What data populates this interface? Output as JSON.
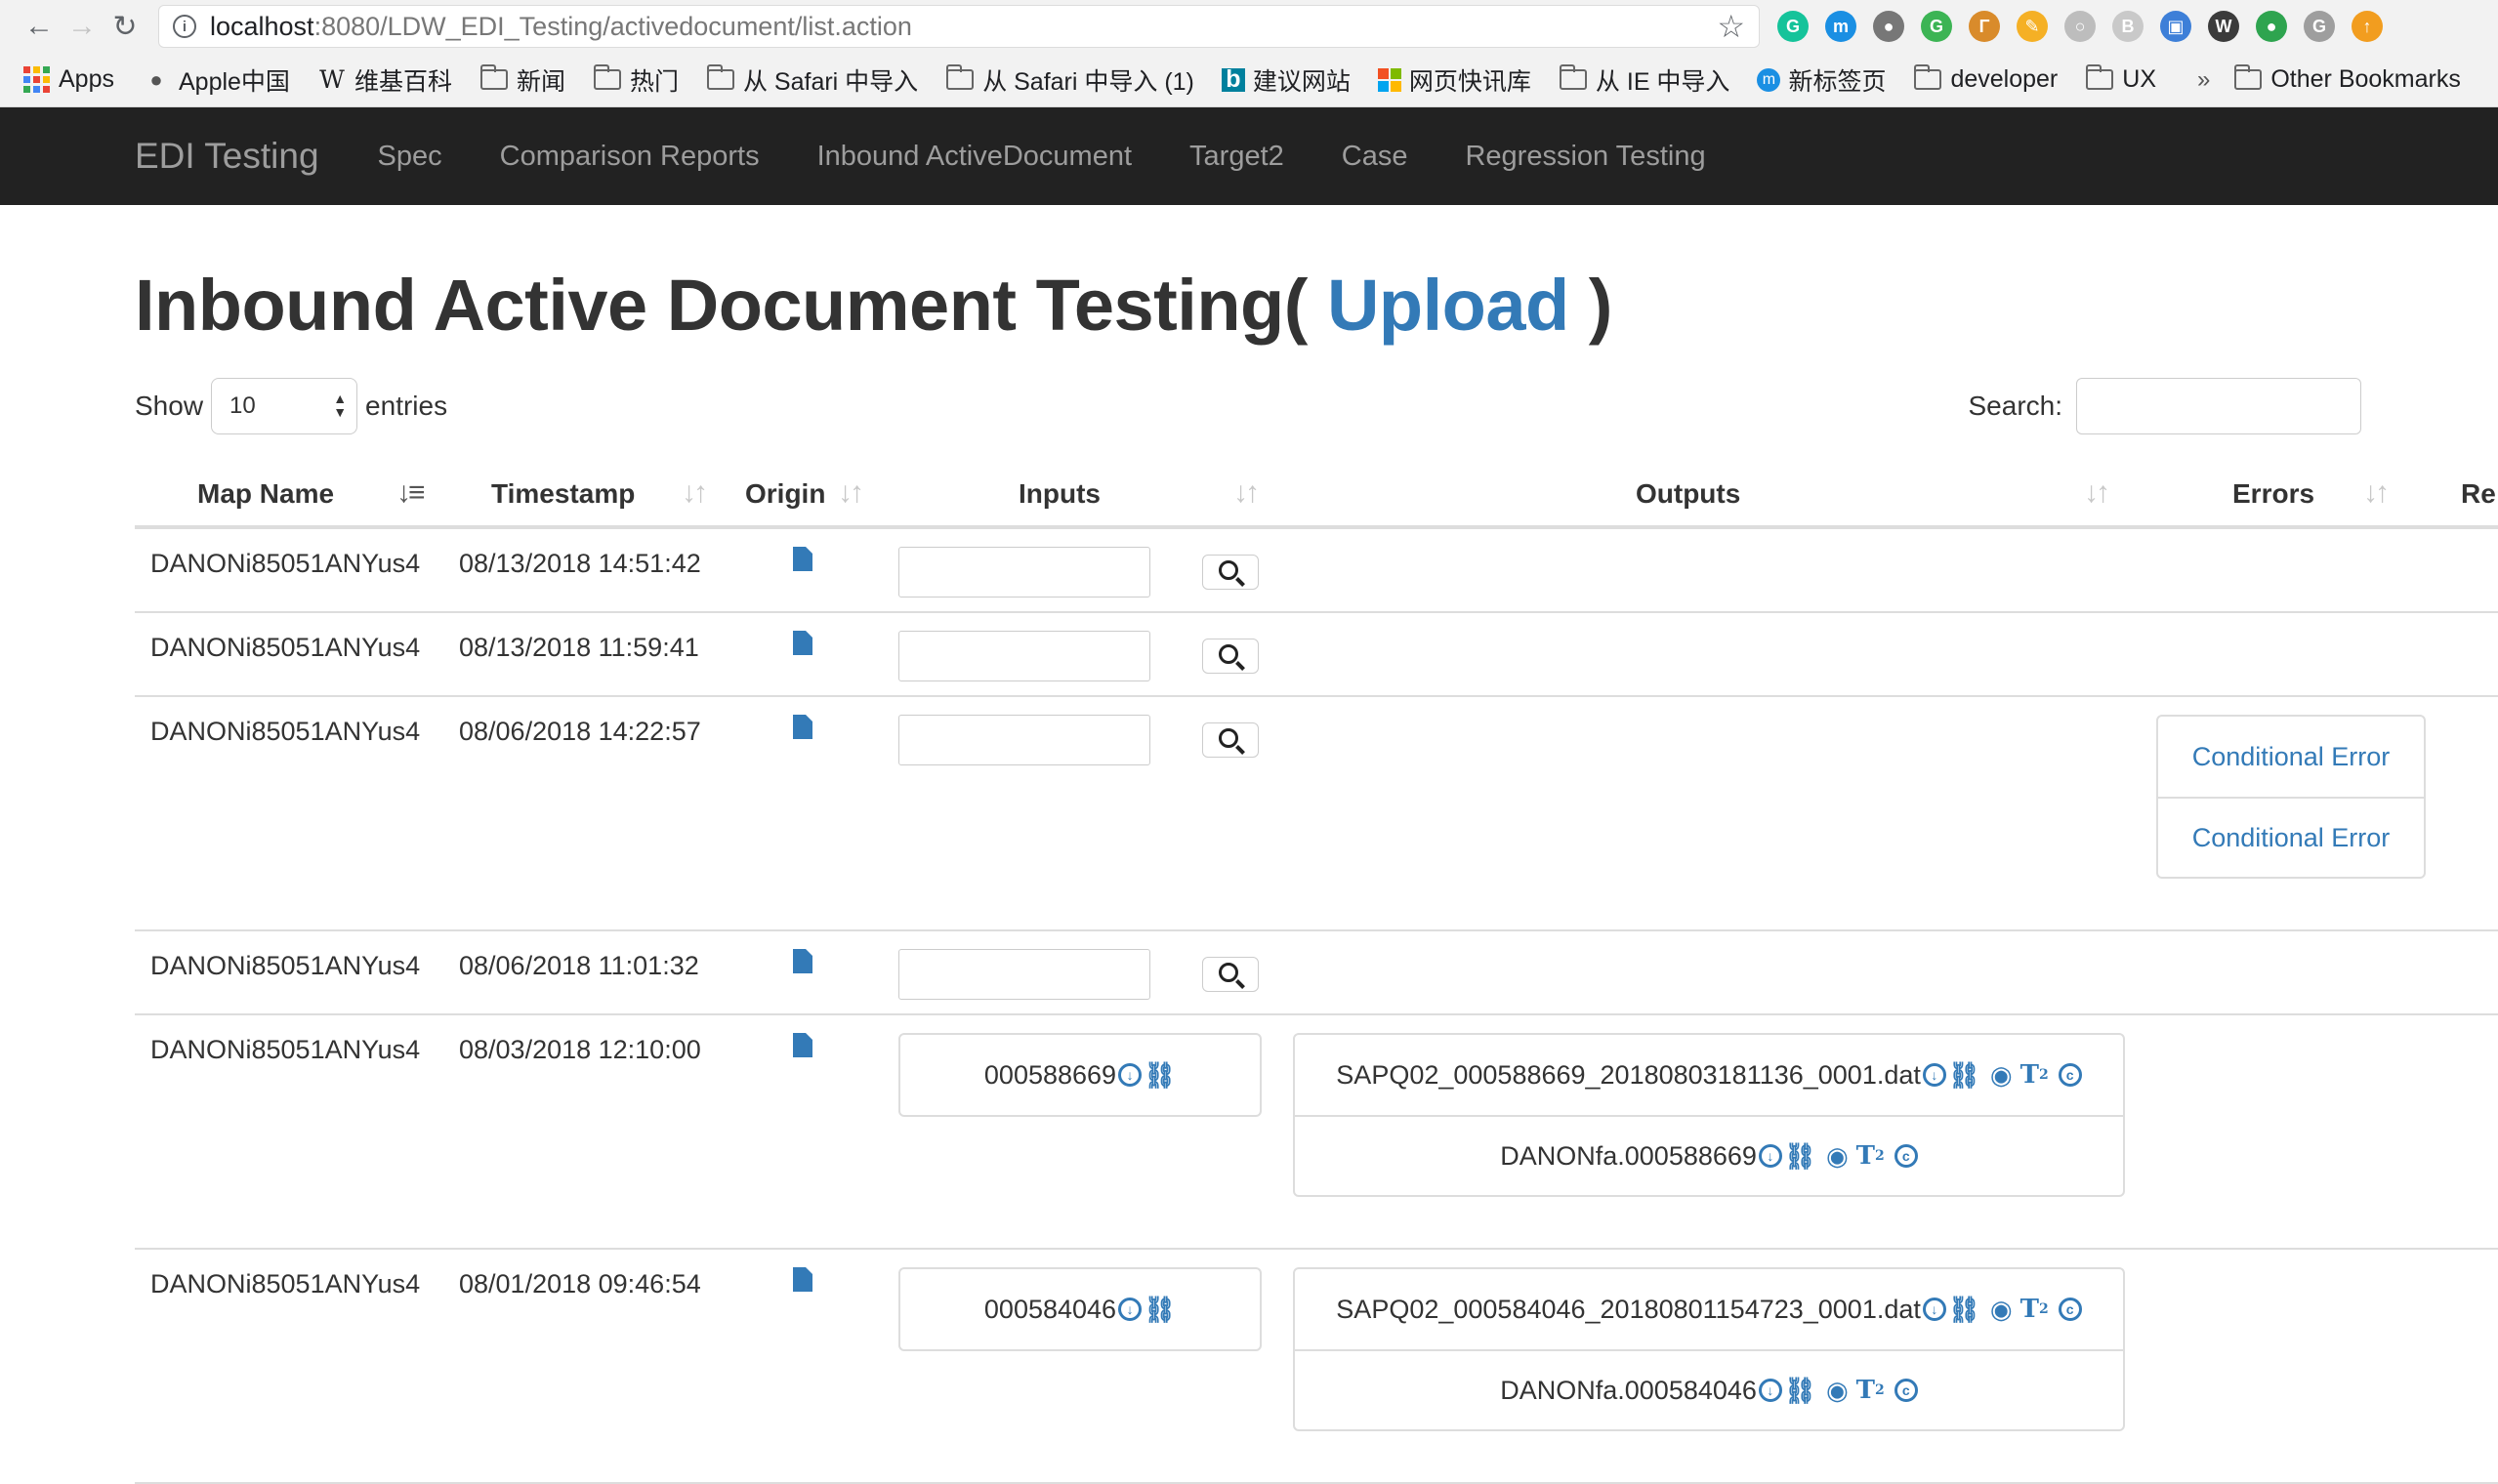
{
  "browser": {
    "url_host": "localhost",
    "url_path": ":8080/LDW_EDI_Testing/activedocument/list.action",
    "extensions": [
      {
        "name": "grammarly-ext-icon",
        "color": "#15c39a",
        "glyph": "G"
      },
      {
        "name": "museum-ext-icon",
        "color": "#1a8fe3",
        "glyph": "m"
      },
      {
        "name": "brain-ext-icon",
        "color": "#777777",
        "glyph": "●"
      },
      {
        "name": "grammarly-green-ext-icon",
        "color": "#3cb454",
        "glyph": "G"
      },
      {
        "name": "ruler-ext-icon",
        "color": "#d98b2b",
        "glyph": "Γ"
      },
      {
        "name": "pencil-ext-icon",
        "color": "#f5b025",
        "glyph": "✎"
      },
      {
        "name": "circle-ext-icon",
        "color": "#bdbdbd",
        "glyph": "○"
      },
      {
        "name": "b-ext-icon",
        "color": "#c9c9c9",
        "glyph": "B"
      },
      {
        "name": "screen-ext-icon",
        "color": "#3d7fd8",
        "glyph": "▣"
      },
      {
        "name": "w-ext-icon",
        "color": "#3b3b3b",
        "glyph": "W"
      },
      {
        "name": "green-dot-ext-icon",
        "color": "#2ea44f",
        "glyph": "●"
      },
      {
        "name": "g-gray-ext-icon",
        "color": "#9e9e9e",
        "glyph": "G"
      },
      {
        "name": "upload-ext-icon",
        "color": "#f29d1f",
        "glyph": "↑"
      }
    ]
  },
  "bookmarks": {
    "items": [
      {
        "label": "Apps",
        "icon": "apps-icon"
      },
      {
        "label": "Apple中国",
        "icon": "apple-icon"
      },
      {
        "label": "维基百科",
        "icon": "wikipedia-icon"
      },
      {
        "label": "新闻",
        "icon": "folder-icon"
      },
      {
        "label": "热门",
        "icon": "folder-icon"
      },
      {
        "label": "从 Safari 中导入",
        "icon": "folder-icon"
      },
      {
        "label": "从 Safari 中导入 (1)",
        "icon": "folder-icon"
      },
      {
        "label": "建议网站",
        "icon": "bing-icon"
      },
      {
        "label": "网页快讯库",
        "icon": "windows-icon"
      },
      {
        "label": "从 IE 中导入",
        "icon": "folder-icon"
      },
      {
        "label": "新标签页",
        "icon": "museum-icon"
      },
      {
        "label": "developer",
        "icon": "folder-icon"
      },
      {
        "label": "UX",
        "icon": "folder-icon"
      }
    ],
    "overflow": "»",
    "other": "Other Bookmarks"
  },
  "navbar": {
    "brand": "EDI Testing",
    "links": [
      "Spec",
      "Comparison Reports",
      "Inbound ActiveDocument",
      "Target2",
      "Case",
      "Regression Testing"
    ]
  },
  "page": {
    "title_prefix": "Inbound Active Document Testing(",
    "upload_link": "Upload",
    "title_suffix": ")",
    "show_label": "Show",
    "entries_value": "10",
    "entries_label": "entries",
    "search_label": "Search:"
  },
  "table": {
    "columns": [
      "Map Name",
      "Timestamp",
      "Origin",
      "Inputs",
      "Outputs",
      "Errors",
      "Re"
    ],
    "rows": [
      {
        "map": "DANONi85051ANYus4",
        "ts": "08/13/2018 14:51:42"
      },
      {
        "map": "DANONi85051ANYus4",
        "ts": "08/13/2018 11:59:41"
      },
      {
        "map": "DANONi85051ANYus4",
        "ts": "08/06/2018 14:22:57",
        "errors": [
          "Conditional Error",
          "Conditional Error"
        ]
      },
      {
        "map": "DANONi85051ANYus4",
        "ts": "08/06/2018 11:01:32"
      },
      {
        "map": "DANONi85051ANYus4",
        "ts": "08/03/2018 12:10:00",
        "input": "000588669",
        "outputs": [
          "SAPQ02_000588669_20180803181136_0001.dat",
          "DANONfa.000588669"
        ]
      },
      {
        "map": "DANONi85051ANYus4",
        "ts": "08/01/2018 09:46:54",
        "input": "000584046",
        "outputs": [
          "SAPQ02_000584046_20180801154723_0001.dat",
          "DANONfa.000584046"
        ]
      }
    ]
  }
}
